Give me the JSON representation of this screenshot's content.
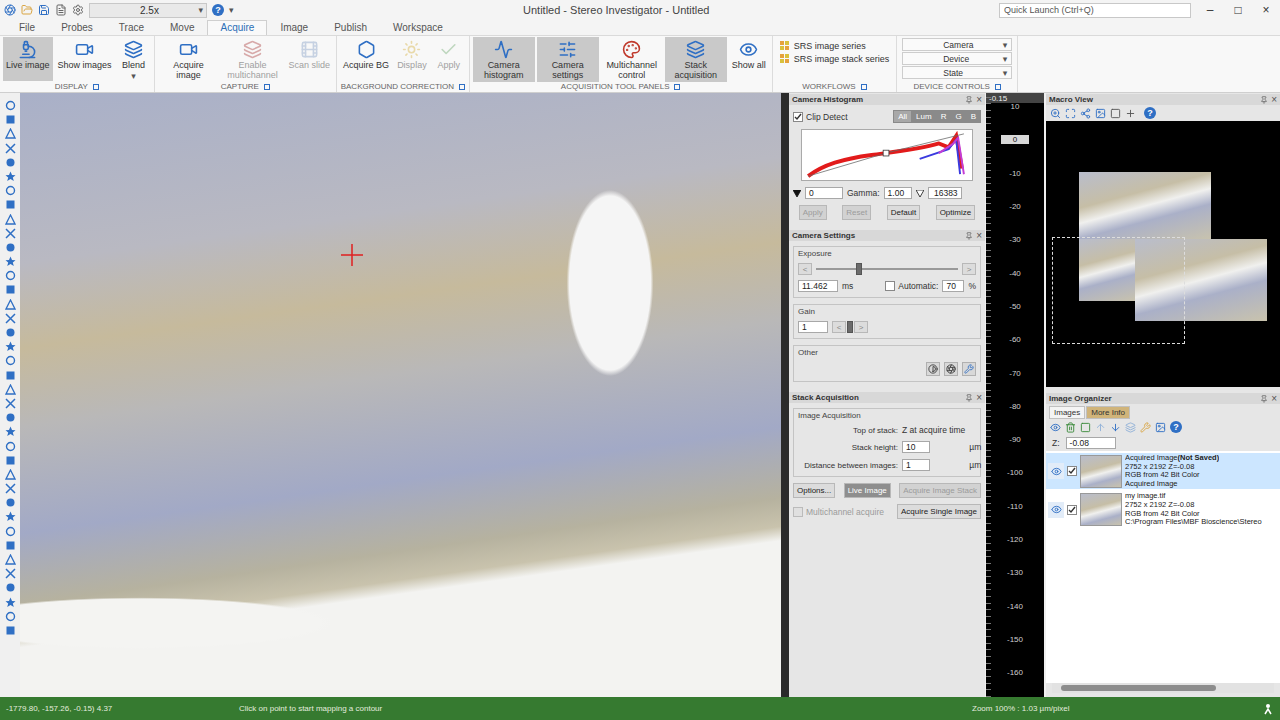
{
  "window": {
    "title": "Untitled - Stereo Investigator - Untitled",
    "zoom": "2.5x",
    "help": "?",
    "quick_launch": {
      "placeholder": "Quick Launch (Ctrl+Q)"
    },
    "controls": [
      "–",
      "□",
      "×"
    ]
  },
  "glyphs": {
    "dropdown": "▾",
    "close": "×"
  },
  "tabs": [
    {
      "label": "File",
      "selected": false
    },
    {
      "label": "Probes",
      "selected": false
    },
    {
      "label": "Trace",
      "selected": false
    },
    {
      "label": "Move",
      "selected": false
    },
    {
      "label": "Acquire",
      "selected": true
    },
    {
      "label": "Image",
      "selected": false
    },
    {
      "label": "Publish",
      "selected": false
    },
    {
      "label": "Workspace",
      "selected": false
    }
  ],
  "ribbon": {
    "groups": [
      {
        "label": "DISPLAY",
        "kind": "buttons",
        "items": [
          {
            "label": "Live image",
            "selected": true,
            "disabled": false,
            "dropdown": false
          },
          {
            "label": "Show images",
            "selected": false,
            "disabled": false,
            "dropdown": false
          },
          {
            "label": "Blend",
            "selected": false,
            "disabled": false,
            "dropdown": true
          }
        ]
      },
      {
        "label": "CAPTURE",
        "kind": "buttons",
        "items": [
          {
            "label": "Acquire image",
            "selected": false,
            "disabled": false,
            "dropdown": false
          },
          {
            "label": "Enable multichannel",
            "selected": false,
            "disabled": true,
            "dropdown": false
          },
          {
            "label": "Scan slide",
            "selected": false,
            "disabled": true,
            "dropdown": false
          }
        ]
      },
      {
        "label": "BACKGROUND CORRECTION",
        "kind": "buttons",
        "items": [
          {
            "label": "Acquire BG",
            "selected": false,
            "disabled": false,
            "dropdown": false
          },
          {
            "label": "Display",
            "selected": false,
            "disabled": true,
            "dropdown": false
          },
          {
            "label": "Apply",
            "selected": false,
            "disabled": true,
            "dropdown": false
          }
        ]
      },
      {
        "label": "ACQUISITION TOOL PANELS",
        "kind": "buttons",
        "items": [
          {
            "label": "Camera histogram",
            "selected": true,
            "disabled": false,
            "dropdown": false
          },
          {
            "label": "Camera settings",
            "selected": true,
            "disabled": false,
            "dropdown": false
          },
          {
            "label": "Multichannel control",
            "selected": false,
            "disabled": false,
            "dropdown": false
          },
          {
            "label": "Stack acquisition",
            "selected": true,
            "disabled": false,
            "dropdown": false
          },
          {
            "label": "Show all",
            "selected": false,
            "disabled": false,
            "dropdown": false
          }
        ]
      },
      {
        "label": "WORKFLOWS",
        "kind": "links",
        "items": [
          {
            "label": "SRS image series"
          },
          {
            "label": "SRS image stack series"
          }
        ]
      },
      {
        "label": "DEVICE CONTROLS",
        "kind": "dropdowns",
        "items": [
          {
            "label": "Camera"
          },
          {
            "label": "Device"
          },
          {
            "label": "State"
          }
        ]
      }
    ]
  },
  "image_view": {
    "marker": {
      "shown": true
    }
  },
  "camera_histogram": {
    "title": "Camera Histogram",
    "clip_detect": {
      "label": "Clip Detect",
      "checked": true
    },
    "channels": [
      {
        "label": "All",
        "selected": true
      },
      {
        "label": "Lum",
        "selected": false
      },
      {
        "label": "R",
        "selected": false
      },
      {
        "label": "G",
        "selected": false
      },
      {
        "label": "B",
        "selected": false
      }
    ],
    "low": "0",
    "gamma_label": "Gamma:",
    "gamma": "1.00",
    "high": "16383",
    "buttons": [
      {
        "label": "Apply",
        "disabled": true
      },
      {
        "label": "Reset",
        "disabled": true
      },
      {
        "label": "Default",
        "disabled": false
      },
      {
        "label": "Optimize",
        "disabled": false
      }
    ]
  },
  "camera_settings": {
    "title": "Camera Settings",
    "exposure": {
      "label": "Exposure",
      "dec": "<",
      "inc": ">",
      "level": 0.3,
      "value": "11.462",
      "unit": "ms",
      "automatic": {
        "label": "Automatic:",
        "checked": false
      },
      "target": "70",
      "target_unit": "%"
    },
    "gain": {
      "label": "Gain",
      "value": "1",
      "dec": "<",
      "inc": ">",
      "level": 0.05
    },
    "other": {
      "label": "Other"
    }
  },
  "stack_acquisition": {
    "title": "Stack Acquisition",
    "group": "Image Acquisition",
    "rows": [
      {
        "label": "Top of stack:",
        "kind": "text",
        "value": "Z at acquire time",
        "unit": ""
      },
      {
        "label": "Stack height:",
        "kind": "field",
        "value": "10",
        "unit": "µm"
      },
      {
        "label": "Distance between images:",
        "kind": "field",
        "value": "1",
        "unit": "µm"
      }
    ],
    "buttons": [
      {
        "label": "Options...",
        "selected": false,
        "disabled": false
      },
      {
        "label": "Live Image",
        "selected": true,
        "disabled": false
      },
      {
        "label": "Acquire Image Stack",
        "selected": false,
        "disabled": true
      }
    ],
    "multichannel": {
      "label": "Multichannel acquire",
      "checked": false,
      "disabled": true
    },
    "single": {
      "label": "Acquire Single Image"
    }
  },
  "focus_ruler": {
    "position": "-0.15",
    "ticks": [
      {
        "label": "10",
        "marker": false
      },
      {
        "label": "0",
        "marker": true
      },
      {
        "label": "-10",
        "marker": false
      },
      {
        "label": "-20",
        "marker": false
      },
      {
        "label": "-30",
        "marker": false
      },
      {
        "label": "-40",
        "marker": false
      },
      {
        "label": "-50",
        "marker": false
      },
      {
        "label": "-60",
        "marker": false
      },
      {
        "label": "-70",
        "marker": false
      },
      {
        "label": "-80",
        "marker": false
      },
      {
        "label": "-90",
        "marker": false
      },
      {
        "label": "-100",
        "marker": false
      },
      {
        "label": "-110",
        "marker": false
      },
      {
        "label": "-120",
        "marker": false
      },
      {
        "label": "-130",
        "marker": false
      },
      {
        "label": "-140",
        "marker": false
      },
      {
        "label": "-150",
        "marker": false
      },
      {
        "label": "-160",
        "marker": false
      }
    ]
  },
  "macro_view": {
    "title": "Macro View",
    "help": "?"
  },
  "image_organizer": {
    "title": "Image Organizer",
    "tabs": [
      {
        "label": "Images",
        "selected": true
      },
      {
        "label": "More Info",
        "selected": false
      }
    ],
    "help": "?",
    "z_label": "Z:",
    "z": "-0.08",
    "images": [
      {
        "name": "Acquired Image",
        "note": "(Not Saved)",
        "size": "2752 x 2192 Z=-0.08",
        "format": "RGB from 42 Bit Color",
        "source": "Acquired Image",
        "visible": true,
        "checked": true,
        "selected": true
      },
      {
        "name": "my image.tif",
        "note": "",
        "size": "2752 x 2192 Z=-0.08",
        "format": "RGB from 42 Bit Color",
        "source": "C:\\Program Files\\MBF Bioscience\\Stereo",
        "visible": true,
        "checked": true,
        "selected": false
      }
    ],
    "scrollbar": {
      "level": 0.7
    }
  },
  "status_bar": {
    "coords": "-1779.80, -157.26, -0.15) 4.37",
    "message": "Click on point to start mapping a contour",
    "zoom": "Zoom 100% : 1.03 µm/pixel"
  }
}
